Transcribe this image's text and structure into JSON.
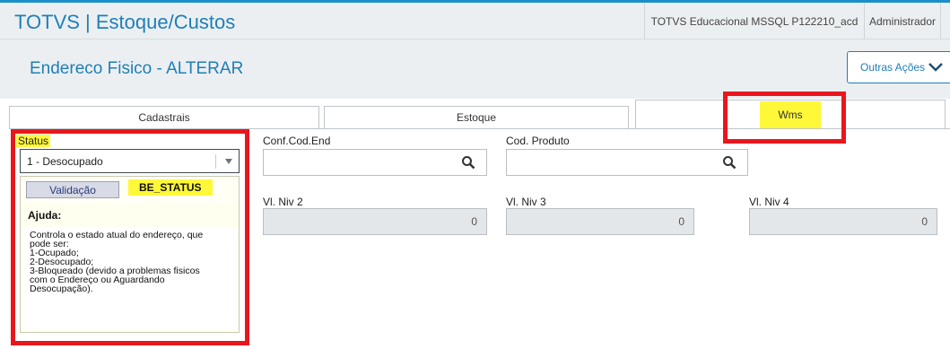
{
  "header": {
    "app_title": "TOTVS | Estoque/Custos",
    "environment": "TOTVS Educacional MSSQL P122210_acd",
    "user": "Administrador"
  },
  "page": {
    "title": "Endereco Fisico - ALTERAR",
    "other_actions_label": "Outras Ações"
  },
  "tabs": [
    {
      "label": "Cadastrais",
      "active": false
    },
    {
      "label": "Estoque",
      "active": false
    },
    {
      "label": "Wms",
      "active": true
    }
  ],
  "form": {
    "status": {
      "label": "Status",
      "value": "1 - Desocupado"
    },
    "conf_cod_end": {
      "label": "Conf.Cod.End",
      "value": ""
    },
    "cod_produto": {
      "label": "Cod. Produto",
      "value": ""
    },
    "vl_niv_2": {
      "label": "Vl. Niv 2",
      "value": "0"
    },
    "vl_niv_3": {
      "label": "Vl. Niv 3",
      "value": "0"
    },
    "vl_niv_4": {
      "label": "Vl. Niv 4",
      "value": "0"
    }
  },
  "help_popup": {
    "validation_button": "Validação",
    "field_code": "BE_STATUS",
    "ajuda_label": "Ajuda:",
    "text": "Controla o estado atual do endereço, que\npode ser:\n1-Ocupado;\n2-Desocupado;\n3-Bloqueado (devido a  problemas fisicos\ncom o Endereço ou Aguardando\nDesocupação)."
  },
  "colors": {
    "accent": "#1d7fb8",
    "highlight": "#fff838",
    "annotation_red": "#e8171d"
  }
}
